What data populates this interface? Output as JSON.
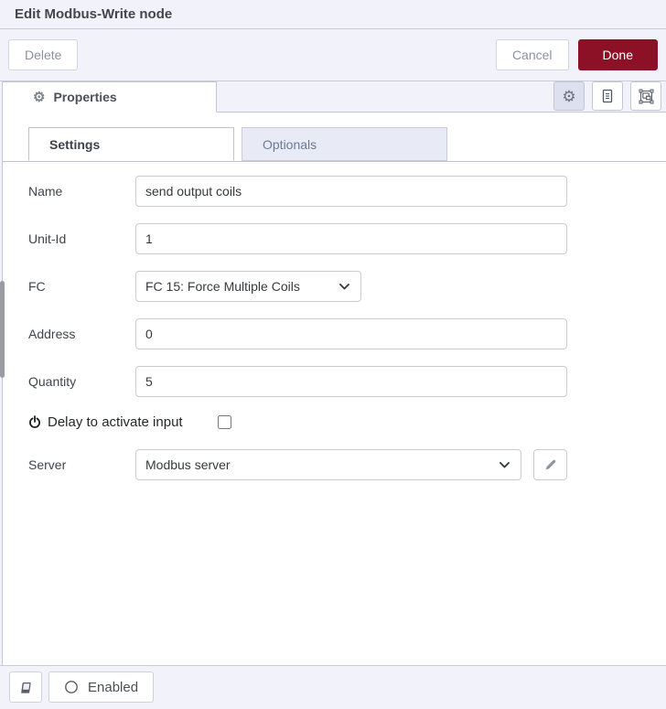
{
  "window": {
    "title": "Edit Modbus-Write node"
  },
  "toolbar": {
    "delete_label": "Delete",
    "cancel_label": "Cancel",
    "done_label": "Done"
  },
  "editor": {
    "properties_tab_label": "Properties",
    "tabs": {
      "settings": "Settings",
      "optionals": "Optionals"
    }
  },
  "form": {
    "name": {
      "label": "Name",
      "value": "send output coils"
    },
    "unit_id": {
      "label": "Unit-Id",
      "value": "1"
    },
    "fc": {
      "label": "FC",
      "selected": "FC 15: Force Multiple Coils"
    },
    "address": {
      "label": "Address",
      "value": "0"
    },
    "quantity": {
      "label": "Quantity",
      "value": "5"
    },
    "delay": {
      "label": "Delay to activate input",
      "checked": false
    },
    "server": {
      "label": "Server",
      "selected": "Modbus server"
    }
  },
  "footer": {
    "enabled_label": "Enabled"
  },
  "colors": {
    "accent_red": "#8c1127",
    "chrome_bg": "#f1f2fa",
    "optionals_tab_bg": "#e8eaf6",
    "active_header_button_bg": "#dde0ee"
  },
  "icons": {
    "properties_tab": "gear-icon",
    "header_buttons": [
      "gear-icon",
      "document-icon",
      "group-select-icon"
    ],
    "delay": "power-icon",
    "server_edit": "pencil-icon",
    "footer": [
      "book-icon",
      "circle-icon"
    ]
  }
}
